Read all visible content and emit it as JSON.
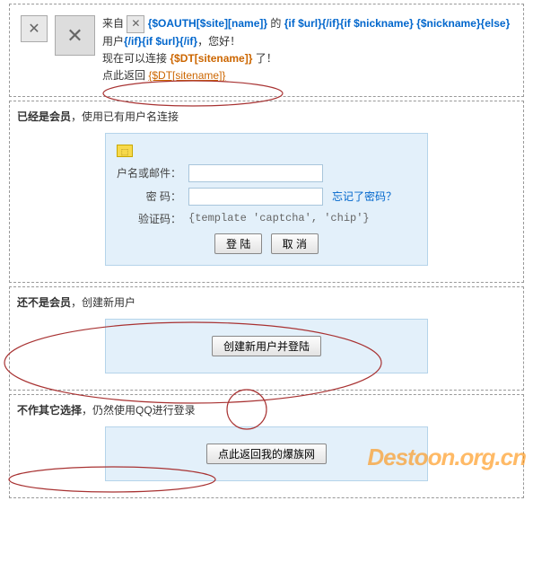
{
  "top": {
    "prefix": "来自",
    "oauth_name": "{$OAUTH[$site][name]}",
    "de": " 的 ",
    "if_url1": "{if $url}",
    "endif1": "{/if}",
    "if_nick": "{if $nickname}",
    "nick": "{$nickname}",
    "else": "{else}",
    "user_label": "用户",
    "endif2": "{/if}",
    "if_url2": "{if $url}",
    "endif3": "{/if}",
    "greet": "，您好！",
    "now_connect": "现在可以连接",
    "sitename": "{$DT[sitename]}",
    "le": "了！",
    "return_prefix": "点此返回",
    "return_site": "{$DT[sitename]}"
  },
  "member": {
    "title": "已经是会员",
    "subtitle": "，使用已有用户名连接",
    "username_label": "户名或邮件：",
    "password_label": "密 码：",
    "forgot": "忘记了密码？",
    "captcha_label": "验证码：",
    "captcha_tpl": "{template 'captcha', 'chip'}",
    "login_btn": "登 陆",
    "cancel_btn": "取 消"
  },
  "newuser": {
    "title": "还不是会员",
    "subtitle": "，创建新用户",
    "create_btn": "创建新用户并登陆"
  },
  "qq": {
    "title": "不作其它选择",
    "subtitle": "，仍然使用QQ进行登录",
    "return_btn": "点此返回我的爆族网"
  },
  "watermark": "Destoon.org.cn"
}
